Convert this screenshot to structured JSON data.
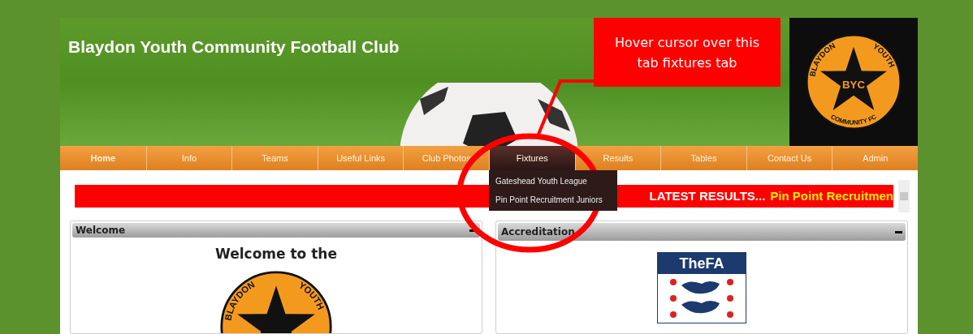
{
  "header": {
    "title": "Blaydon Youth Community Football Club",
    "logo": {
      "arc_left": "BLAYDON",
      "arc_right": "YOUTH",
      "initials": "BYC",
      "arc_bottom": "COMMUNITY FC"
    }
  },
  "nav": {
    "tabs": [
      {
        "label": "Home",
        "selected": false,
        "current": true
      },
      {
        "label": "Info",
        "selected": false,
        "current": false
      },
      {
        "label": "Teams",
        "selected": false,
        "current": false
      },
      {
        "label": "Useful Links",
        "selected": false,
        "current": false
      },
      {
        "label": "Club Photos",
        "selected": false,
        "current": false
      },
      {
        "label": "Fixtures",
        "selected": true,
        "current": false,
        "dropdown": [
          "Gateshead Youth League",
          "Pin Point Recruitment Juniors"
        ]
      },
      {
        "label": "Results",
        "selected": false,
        "current": false
      },
      {
        "label": "Tables",
        "selected": false,
        "current": false
      },
      {
        "label": "Contact Us",
        "selected": false,
        "current": false
      },
      {
        "label": "Admin",
        "selected": false,
        "current": false
      }
    ]
  },
  "ticker": {
    "lead": "LATEST RESULTS...",
    "text": "Pin Point Recruitmen"
  },
  "panels": [
    {
      "title": "Welcome",
      "kind": "welcome",
      "heading": "Welcome to the",
      "logo": {
        "arc_left": "BLAYDON",
        "arc_right": "YOUTH"
      }
    },
    {
      "title": "Accreditation",
      "kind": "fa",
      "badge": "TheFA"
    }
  ],
  "annotation": {
    "text": "Hover cursor over this tab fixtures tab"
  }
}
